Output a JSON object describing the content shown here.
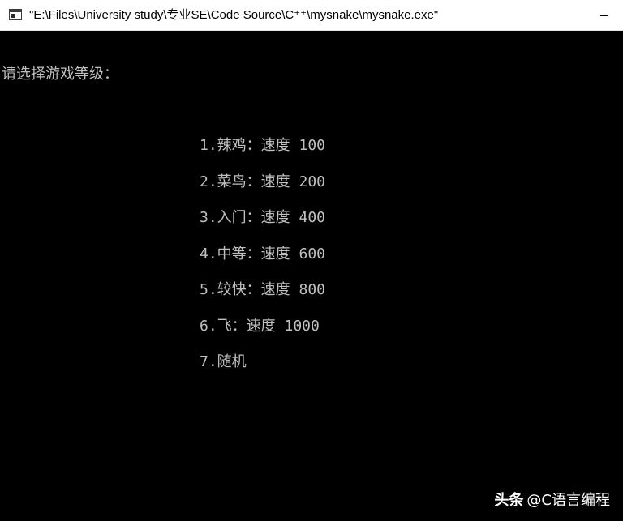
{
  "window": {
    "title": "\"E:\\Files\\University study\\专业SE\\Code Source\\C⁺⁺\\mysnake\\mysnake.exe\""
  },
  "console": {
    "prompt": "请选择游戏等级：",
    "levels": [
      "1.辣鸡：速度 100",
      "2.菜鸟：速度 200",
      "3.入门：速度 400",
      "4.中等：速度 600",
      "5.较快：速度 800",
      "6.飞：速度 1000",
      "7.随机"
    ]
  },
  "watermark": {
    "brand": "头条",
    "handle": "@C语言编程"
  },
  "colors": {
    "console_bg": "#000000",
    "console_text": "#c0c0c0",
    "titlebar_bg": "#ffffff"
  },
  "icons": {
    "app": "console-window-icon",
    "minimize": "minimize-icon"
  }
}
